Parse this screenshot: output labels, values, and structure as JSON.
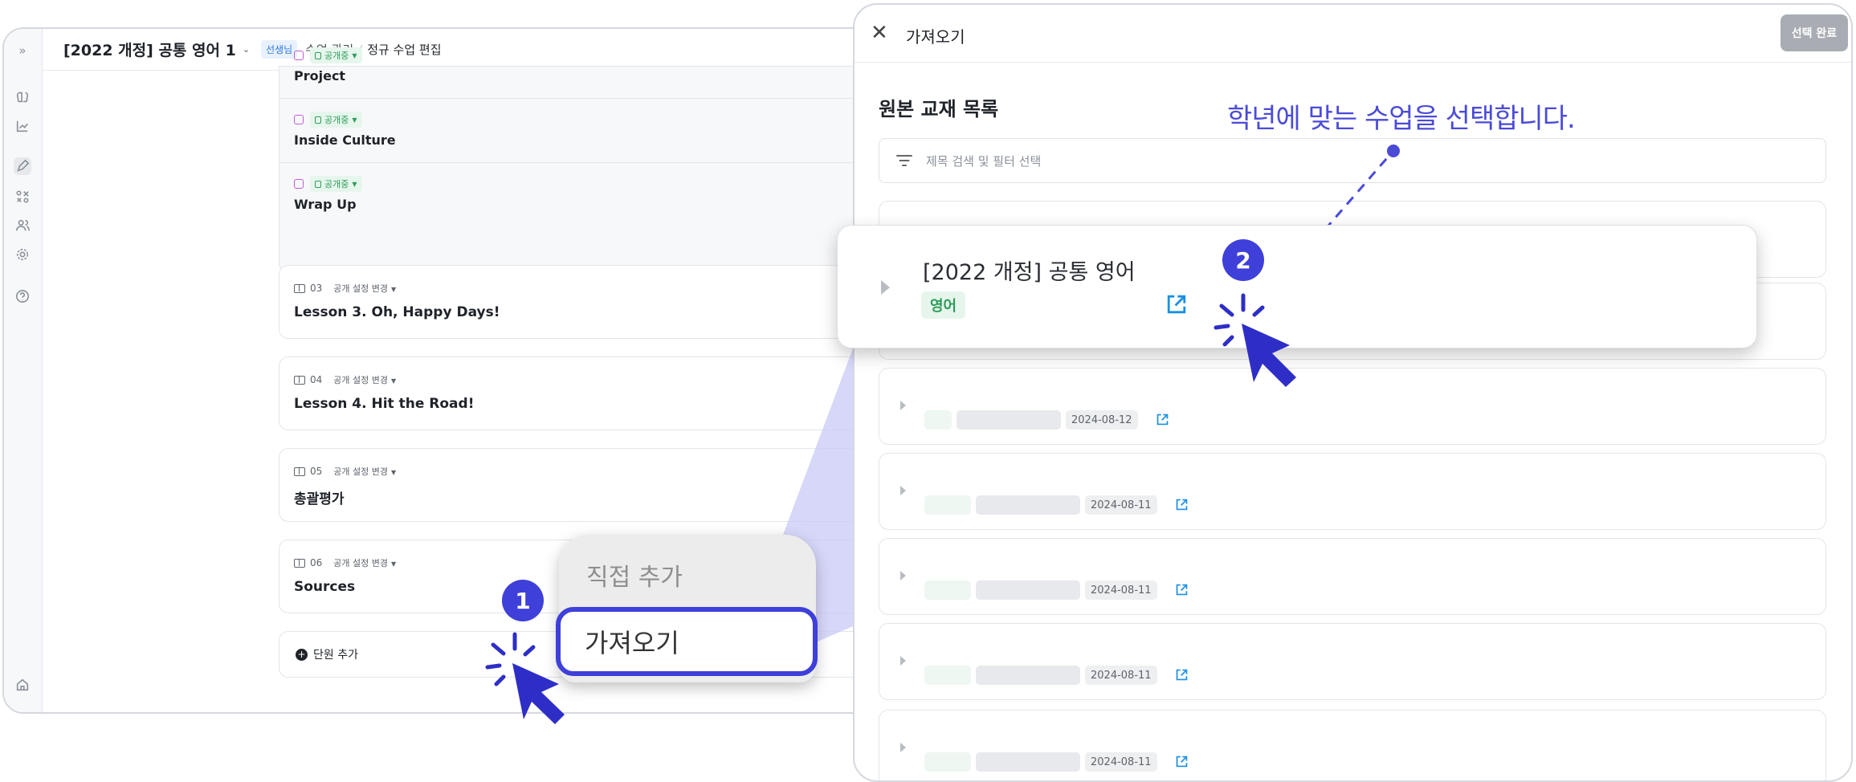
{
  "app": {
    "title": "[2022 개정] 공통 영어 1",
    "teacher_badge": "선생님",
    "breadcrumb_1": "수업 관리",
    "breadcrumb_sep": "/",
    "breadcrumb_2": "정규 수업 편집"
  },
  "sidebar": {
    "icons": [
      "brain-icon",
      "chart-icon",
      "pencil-icon",
      "grid-icon",
      "users-icon",
      "settings-icon",
      "help-icon",
      "home-icon"
    ]
  },
  "lesson_items": [
    {
      "status": "공개중",
      "title": "Project"
    },
    {
      "status": "공개중",
      "title": "Inside Culture"
    },
    {
      "status": "공개중",
      "title": "Wrap Up"
    }
  ],
  "units": [
    {
      "num": "03",
      "setting": "공개 설정 변경",
      "title": "Lesson 3. Oh, Happy Days!"
    },
    {
      "num": "04",
      "setting": "공개 설정 변경",
      "title": "Lesson 4. Hit the Road!"
    },
    {
      "num": "05",
      "setting": "공개 설정 변경",
      "title": "총괄평가"
    },
    {
      "num": "06",
      "setting": "공개 설정 변경",
      "title": "Sources"
    }
  ],
  "add_unit_label": "단원 추가",
  "add_menu": {
    "direct_add": "직접 추가",
    "import": "가져오기"
  },
  "panel": {
    "title": "가져오기",
    "done_button": "선택 완료",
    "section_title": "원본 교재 목록",
    "search_placeholder": "제목 검색 및 필터 선택",
    "highlight_book": {
      "title": "[2022 개정] 공통 영어",
      "tag": "영어"
    },
    "rows": [
      {
        "date": "2024-08-12"
      },
      {
        "date": "2024-08-11"
      },
      {
        "date": "2024-08-11"
      },
      {
        "date": "2024-08-11"
      },
      {
        "date": "2024-08-11"
      }
    ]
  },
  "annotations": {
    "step1": "1",
    "step2": "2",
    "guide": "학년에 맞는 수업을 선택합니다."
  },
  "colors": {
    "accent": "#3f3fd9",
    "green_tag": "#2f9c5a",
    "link_blue": "#1a8fe3"
  }
}
